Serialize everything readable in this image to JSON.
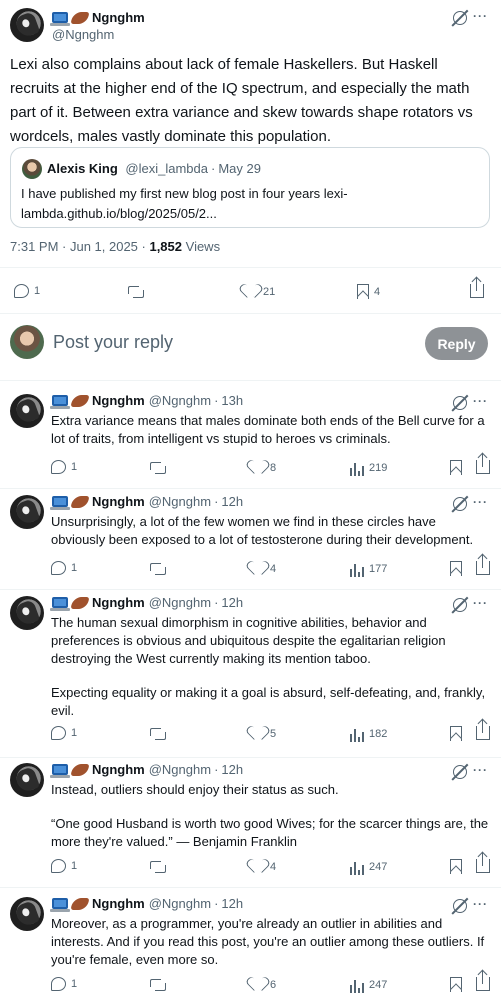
{
  "main_tweet": {
    "display_name": "Ngnghm",
    "handle": "@Ngnghm",
    "text": "Lexi also complains about lack of female Haskellers. But Haskell recruits at the higher end of the IQ spectrum, and especially the math part of it. Between extra variance and skew towards shape rotators vs wordcels, males vastly dominate this population.",
    "quote": {
      "name": "Alexis King",
      "handle": "@lexi_lambda",
      "date": "May 29",
      "text": "I have published my first new blog post in four years lexi-lambda.github.io/blog/2025/05/2..."
    },
    "timestamp": "7:31 PM · Jun 1, 2025 · ",
    "views_count": "1,852",
    "views_label": " Views",
    "replies": "1",
    "retweets": "",
    "likes": "21",
    "bookmarks": "4"
  },
  "reply_box": {
    "placeholder": "Post your reply",
    "button_label": "Reply"
  },
  "replies": [
    {
      "display_name": "Ngnghm",
      "handle": "@Ngnghm",
      "time": "13h",
      "paragraphs": [
        "Extra variance means that males dominate both ends of the Bell curve for a lot of traits, from intelligent vs stupid to heroes vs criminals."
      ],
      "replies": "1",
      "likes": "8",
      "views": "219"
    },
    {
      "display_name": "Ngnghm",
      "handle": "@Ngnghm",
      "time": "12h",
      "paragraphs": [
        "Unsurprisingly, a lot of the few women we find in these circles have obviously been exposed to a lot of testosterone during their development."
      ],
      "replies": "1",
      "likes": "4",
      "views": "177"
    },
    {
      "display_name": "Ngnghm",
      "handle": "@Ngnghm",
      "time": "12h",
      "paragraphs": [
        "The human sexual dimorphism in cognitive abilities, behavior and preferences is obvious and ubiquitous despite the egalitarian religion destroying the West currently making its mention taboo.",
        "Expecting equality or making it a goal is absurd, self-defeating, and, frankly, evil."
      ],
      "replies": "1",
      "likes": "5",
      "views": "182"
    },
    {
      "display_name": "Ngnghm",
      "handle": "@Ngnghm",
      "time": "12h",
      "paragraphs": [
        "Instead, outliers should enjoy their status as such.",
        "“One good Husband is worth two good Wives; for the scarcer things are, the more they're valued.” — Benjamin Franklin"
      ],
      "replies": "1",
      "likes": "4",
      "views": "247"
    },
    {
      "display_name": "Ngnghm",
      "handle": "@Ngnghm",
      "time": "12h",
      "paragraphs": [
        "Moreover, as a programmer, you're already an outlier in abilities and interests. And if you read this post, you're an outlier among these outliers. If you're female, even more so."
      ],
      "replies": "1",
      "likes": "6",
      "views": "247"
    }
  ],
  "icons": {
    "grok": "grok-icon",
    "more": "more-icon",
    "reply": "reply-icon",
    "retweet": "retweet-icon",
    "like": "heart-icon",
    "views": "views-icon",
    "bookmark": "bookmark-icon",
    "share": "share-icon"
  },
  "colors": {
    "text": "#0f1419",
    "secondary": "#536471",
    "border": "#cfd9de",
    "reply_button": "#8e9296"
  }
}
